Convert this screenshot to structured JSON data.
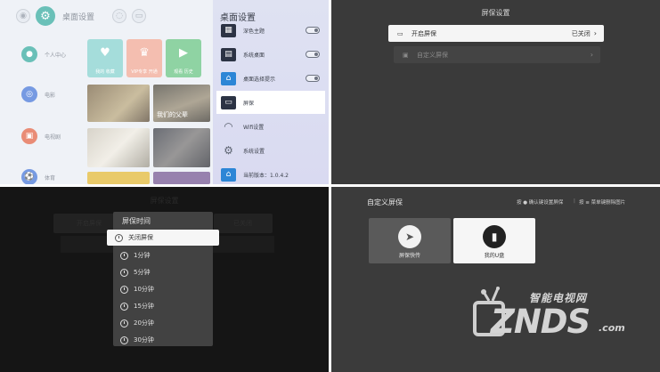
{
  "q1": {
    "header_title": "桌面设置",
    "sidebar": [
      {
        "label": "个人中心",
        "color": "#2aa59a"
      },
      {
        "label": "电影",
        "color": "#3b6fd6"
      },
      {
        "label": "电视剧",
        "color": "#e05b3c"
      },
      {
        "label": "体育",
        "color": "#3b6fd6"
      }
    ],
    "apps": [
      {
        "label": "我的 收藏",
        "color": "#7fcfcc"
      },
      {
        "label": "VIP专享 开通",
        "color": "#f0a38e"
      },
      {
        "label": "观看 历史",
        "color": "#5fc07b"
      }
    ],
    "poster_caption": "我们的父辈",
    "settings_panel": {
      "title": "桌面设置",
      "items": [
        {
          "label": "深色主题",
          "toggle": true,
          "icon": "theme-icon"
        },
        {
          "label": "系统桌面",
          "toggle": true,
          "icon": "desktop-icon"
        },
        {
          "label": "桌面选择提示",
          "toggle": true,
          "icon": "home-icon"
        },
        {
          "label": "屏保",
          "toggle": false,
          "icon": "screensaver-icon",
          "selected": true
        },
        {
          "label": "Wifi设置",
          "toggle": false,
          "icon": "wifi-icon"
        },
        {
          "label": "系统设置",
          "toggle": false,
          "icon": "gear-icon"
        },
        {
          "label": "当前版本：1.0.4.2",
          "toggle": false,
          "icon": "home-icon"
        }
      ]
    }
  },
  "q2": {
    "title": "屏保设置",
    "rows": [
      {
        "label": "开启屏保",
        "value": "已关闭",
        "active": true
      },
      {
        "label": "自定义屏保",
        "value": "",
        "active": false
      }
    ]
  },
  "q3": {
    "ghost_title": "屏保设置",
    "ghost_left": "开启屏保",
    "ghost_right": "已关闭",
    "menu_title": "屏保时间",
    "selected": "关闭屏保",
    "options": [
      "1分钟",
      "5分钟",
      "10分钟",
      "15分钟",
      "20分钟",
      "30分钟"
    ]
  },
  "q4": {
    "title": "自定义屏保",
    "hint1": "按 ● 确认键设置屏保",
    "hint2": "按 ≡ 菜单键删除图片",
    "cards": [
      {
        "label": "屏保快传",
        "icon": "paper-plane-icon"
      },
      {
        "label": "我的U盘",
        "icon": "usb-drive-icon"
      }
    ],
    "watermark_cn": "智能电视网",
    "watermark_main": "ZNDS",
    "watermark_com": ".com"
  }
}
